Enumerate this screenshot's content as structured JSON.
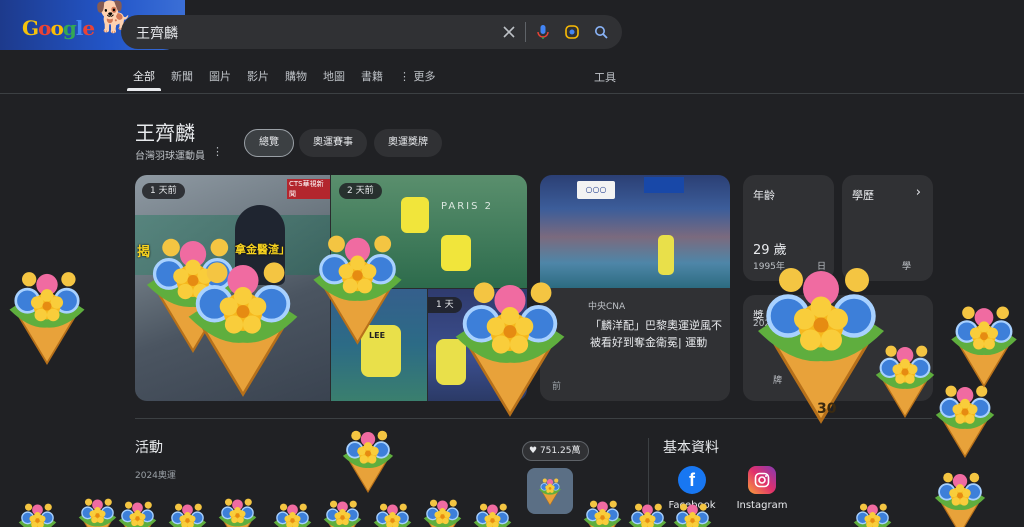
{
  "header": {
    "logo_text": "Google",
    "query": "王齊麟"
  },
  "tabs": [
    {
      "label": "全部",
      "active": true
    },
    {
      "label": "新聞"
    },
    {
      "label": "圖片"
    },
    {
      "label": "影片"
    },
    {
      "label": "購物"
    },
    {
      "label": "地圖"
    },
    {
      "label": "書籍"
    },
    {
      "label": "更多"
    }
  ],
  "tools_label": "工具",
  "entity": {
    "title": "王齊麟",
    "subtitle": "台灣羽球運動員",
    "chips": [
      "總覽",
      "奧運賽事",
      "奧運獎牌"
    ]
  },
  "images": {
    "time_a": "1 天前",
    "time_b": "2 天前",
    "time_d": "1 天",
    "headline_a": "揭",
    "headline_a2": "拿金醫渣」",
    "paris_text": "PARIS 2",
    "cts_tag": "CTS華視新聞",
    "jersey_c": "LEE"
  },
  "news": {
    "source": "中央CNA",
    "title": "「麟洋配」巴黎奧運逆風不被看好到奪金衛冕| 運動",
    "time": "前"
  },
  "info_cards": {
    "age_label": "年齡",
    "age_value": "29 歲",
    "age_sub": "1995年",
    "age_sub_tail": "日",
    "edu_label": "學歷",
    "edu_tail": "學",
    "spouse_label": "獎",
    "spouse_sub": "202",
    "medal_partial": "牌"
  },
  "sections": {
    "activity_title": "活動",
    "activity_sub": "2024奧運",
    "basic_title": "基本資料",
    "socials": [
      "Facebook",
      "Instagram"
    ]
  },
  "celebration": {
    "likes": "751.25萬",
    "counter": "30"
  },
  "colors": {
    "background": "#202124",
    "card": "#303134",
    "accent_yellow": "#f1e53b"
  }
}
